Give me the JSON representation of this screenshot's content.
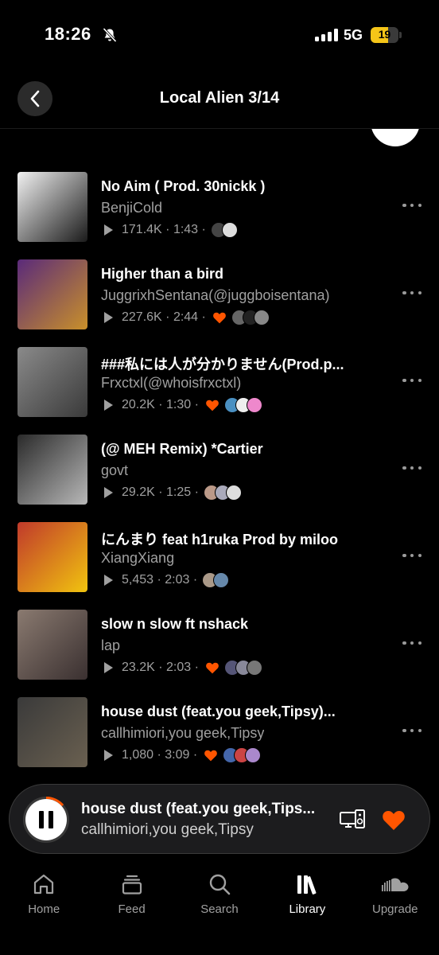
{
  "status_bar": {
    "time": "18:26",
    "network": "5G",
    "battery": "19"
  },
  "header": {
    "title": "Local Alien 3/14"
  },
  "tracks": [
    {
      "title": "No Aim ( Prod. 30nickk )",
      "artist": "BenjiCold",
      "plays": "171.4K",
      "duration": "1:43",
      "liked": false,
      "art_colors": [
        "#f2f2f2",
        "#1a1a1a"
      ]
    },
    {
      "title": "Higher than a bird",
      "artist": "JuggrixhSentana(@juggboisentana)",
      "plays": "227.6K",
      "duration": "2:44",
      "liked": true,
      "art_colors": [
        "#5a2a7a",
        "#c9902a"
      ]
    },
    {
      "title": "###私には人が分かりません(Prod.p...",
      "artist": "Frxctxl(@whoisfrxctxl)",
      "plays": "20.2K",
      "duration": "1:30",
      "liked": true,
      "art_colors": [
        "#8a8a8a",
        "#3a3a3a"
      ]
    },
    {
      "title": "(@ MEH Remix) *Cartier",
      "artist": "govt",
      "plays": "29.2K",
      "duration": "1:25",
      "liked": false,
      "art_colors": [
        "#2a2a2a",
        "#b8b8b8"
      ]
    },
    {
      "title": "にんまり feat h1ruka Prod by miloo",
      "artist": "XiangXiang",
      "plays": "5,453",
      "duration": "2:03",
      "liked": false,
      "art_colors": [
        "#c0392b",
        "#f1c40f"
      ]
    },
    {
      "title": "slow n slow ft nshack",
      "artist": "lap",
      "plays": "23.2K",
      "duration": "2:03",
      "liked": true,
      "art_colors": [
        "#8a7a70",
        "#3a3030"
      ]
    },
    {
      "title": "house dust (feat.you geek,Tipsy)...",
      "artist": "callhimiori,you geek,Tipsy",
      "plays": "1,080",
      "duration": "3:09",
      "liked": true,
      "art_colors": [
        "#3a3a3a",
        "#6a6050"
      ]
    }
  ],
  "mini_player": {
    "title": "house dust (feat.you geek,Tips...",
    "artist": "callhimiori,you geek,Tipsy"
  },
  "nav": [
    {
      "label": "Home",
      "icon": "home-icon"
    },
    {
      "label": "Feed",
      "icon": "feed-icon"
    },
    {
      "label": "Search",
      "icon": "search-icon"
    },
    {
      "label": "Library",
      "icon": "library-icon",
      "active": true
    },
    {
      "label": "Upgrade",
      "icon": "soundcloud-icon"
    }
  ],
  "colors": {
    "accent": "#ff5500",
    "background": "#000000",
    "secondary_text": "#a0a0a0"
  }
}
